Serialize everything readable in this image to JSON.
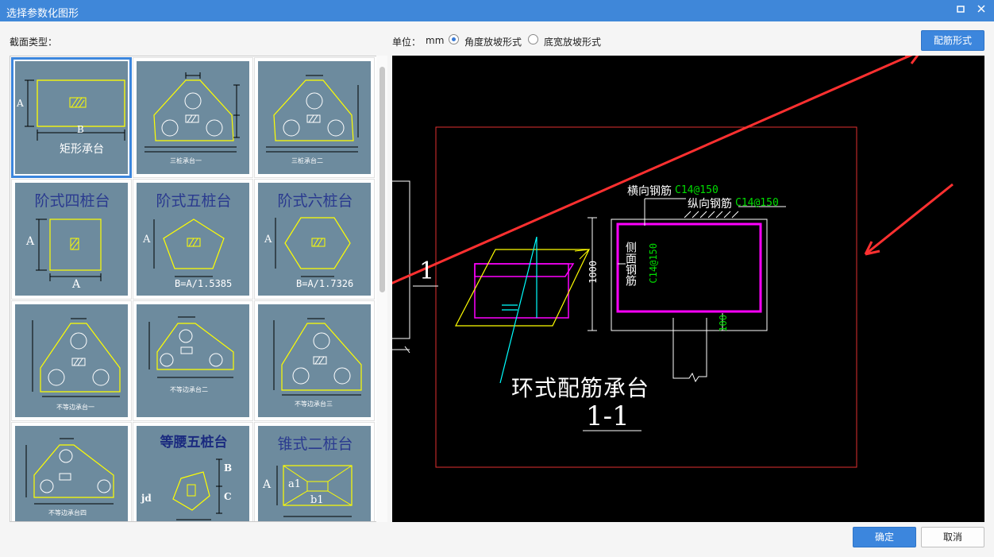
{
  "window": {
    "title": "选择参数化图形",
    "maximize_icon": "maximize-icon",
    "close_icon": "close-icon"
  },
  "header": {
    "section_label": "截面类型：",
    "unit_label": "单位：",
    "unit_value": "mm"
  },
  "slope_options": [
    {
      "label": "角度放坡形式",
      "selected": true
    },
    {
      "label": "底宽放坡形式",
      "selected": false
    }
  ],
  "rebar_button": "配筋形式",
  "tiles": [
    {
      "caption": "矩形承台",
      "selected": true
    },
    {
      "caption": "三桩承台一"
    },
    {
      "caption": "三桩承台二"
    },
    {
      "caption": "阶式四桩台"
    },
    {
      "caption": "阶式五桩台",
      "formula": "B=A/1.5385"
    },
    {
      "caption": "阶式六桩台",
      "formula": "B=A/1.7326"
    },
    {
      "caption": "不等边承台一"
    },
    {
      "caption": "不等边承台二"
    },
    {
      "caption": "不等边承台三"
    },
    {
      "caption": "不等边承台四"
    },
    {
      "caption": "等腰五桩台"
    },
    {
      "caption": "锥式二桩台"
    }
  ],
  "tile_labels": {
    "A": "A",
    "B": "B",
    "C": "C",
    "jd": "jd",
    "a1": "a1",
    "b1": "b1"
  },
  "preview": {
    "section_mark": "1",
    "title": "环式配筋承台",
    "section_name": "1-1",
    "horizontal_rebar": "横向钢筋",
    "horizontal_spec": "C14@150",
    "longitudinal_rebar": "纵向钢筋",
    "longitudinal_spec": "C14@150",
    "side_rebar": "侧面钢筋",
    "side_spec": "C14@150",
    "dim_height": "1000",
    "dim_small": "100"
  },
  "footer": {
    "ok": "确定",
    "cancel": "取消"
  }
}
